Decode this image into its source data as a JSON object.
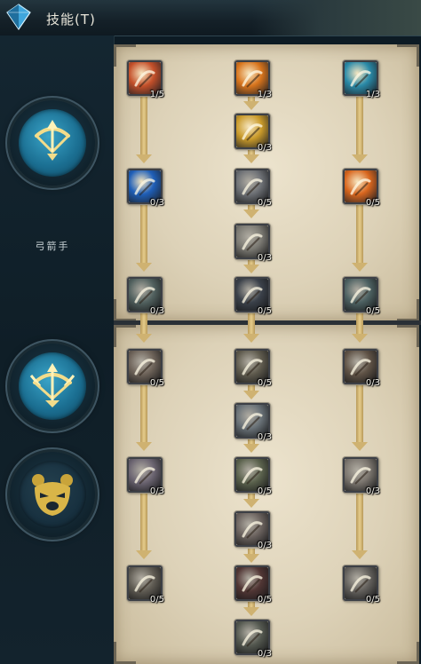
{
  "header": {
    "title": "技能(T)"
  },
  "sidebar": {
    "class_name": "弓箭手",
    "emblems": [
      {
        "icon": "bow-arrow-icon",
        "active": true
      },
      {
        "icon": "winged-bow-icon",
        "active": true
      },
      {
        "icon": "bear-head-icon",
        "active": false
      }
    ]
  },
  "skill_tree_1": {
    "skills": [
      {
        "icon": "fire-slash-icon",
        "level": "1/5",
        "color": "#c4502a",
        "locked": false
      },
      {
        "icon": "explosion-icon",
        "level": "1/3",
        "color": "#d8741c",
        "locked": false
      },
      {
        "icon": "wind-bow-icon",
        "level": "1/3",
        "color": "#2a8aa8",
        "locked": false
      },
      {
        "icon": "golden-orb-icon",
        "level": "0/3",
        "color": "#c99a2a",
        "locked": false
      },
      {
        "icon": "blue-vortex-icon",
        "level": "0/3",
        "color": "#1f5fb8",
        "locked": false
      },
      {
        "icon": "silver-blades-icon",
        "level": "0/5",
        "color": "#8a96a8",
        "locked": true
      },
      {
        "icon": "fire-burst-icon",
        "level": "0/5",
        "color": "#d8661e",
        "locked": false
      },
      {
        "icon": "owl-icon",
        "level": "0/3",
        "color": "#a8a288",
        "locked": true
      },
      {
        "icon": "triple-arrow-icon",
        "level": "0/3",
        "color": "#4f8a82",
        "locked": true
      },
      {
        "icon": "blue-rain-icon",
        "level": "0/5",
        "color": "#41587a",
        "locked": true
      },
      {
        "icon": "ice-shot-icon",
        "level": "0/5",
        "color": "#3f8c8e",
        "locked": true
      }
    ]
  },
  "skill_tree_2": {
    "skills": [
      {
        "icon": "crescent-shot-icon",
        "level": "0/5",
        "color": "#a8805a",
        "locked": true
      },
      {
        "icon": "earth-arrow-icon",
        "level": "0/5",
        "color": "#8a7a48",
        "locked": true
      },
      {
        "icon": "claw-icon",
        "level": "0/3",
        "color": "#9a6a3a",
        "locked": true
      },
      {
        "icon": "frost-fang-icon",
        "level": "0/3",
        "color": "#7a9ab0",
        "locked": true
      },
      {
        "icon": "purple-feather-icon",
        "level": "0/3",
        "color": "#9a80b0",
        "locked": true
      },
      {
        "icon": "green-arrow-icon",
        "level": "0/5",
        "color": "#6f8a3a",
        "locked": true
      },
      {
        "icon": "wolf-icon",
        "level": "0/3",
        "color": "#b09a80",
        "locked": true
      },
      {
        "icon": "beast-claw-icon",
        "level": "0/3",
        "color": "#a08070",
        "locked": true
      },
      {
        "icon": "dusk-knight-icon",
        "level": "0/5",
        "color": "#8a7a5a",
        "locked": true
      },
      {
        "icon": "blood-strike-icon",
        "level": "0/5",
        "color": "#a03a34",
        "locked": true
      },
      {
        "icon": "stone-golem-icon",
        "level": "0/5",
        "color": "#8a8070",
        "locked": true
      },
      {
        "icon": "forest-ranger-icon",
        "level": "0/3",
        "color": "#6a7a5a",
        "locked": true
      }
    ]
  }
}
